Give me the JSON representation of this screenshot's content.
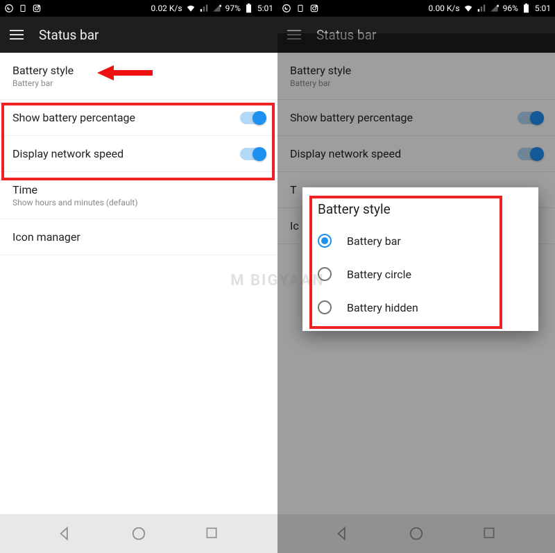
{
  "watermark": "M  BIGYAAN",
  "left": {
    "statusbar": {
      "speed": "0.02 K/s",
      "battery": "97%",
      "time": "5:01"
    },
    "appbar": {
      "title": "Status bar"
    },
    "items": {
      "battery_style": {
        "title": "Battery style",
        "sub": "Battery bar"
      },
      "show_batt_pct": {
        "title": "Show battery percentage"
      },
      "net_speed": {
        "title": "Display network speed"
      },
      "time": {
        "title": "Time",
        "sub": "Show hours and minutes (default)"
      },
      "icon_mgr": {
        "title": "Icon manager"
      }
    }
  },
  "right": {
    "statusbar": {
      "speed": "0.00 K/s",
      "battery": "96%",
      "time": "5:01"
    },
    "appbar": {
      "title": "Status bar"
    },
    "items": {
      "battery_style": {
        "title": "Battery style",
        "sub": "Battery bar"
      },
      "show_batt_pct": {
        "title": "Show battery percentage"
      },
      "net_speed": {
        "title": "Display network speed"
      },
      "time_initial": "T",
      "icon_initial": "Ic"
    },
    "dialog": {
      "title": "Battery style",
      "options": {
        "0": "Battery bar",
        "1": "Battery circle",
        "2": "Battery hidden"
      }
    }
  }
}
